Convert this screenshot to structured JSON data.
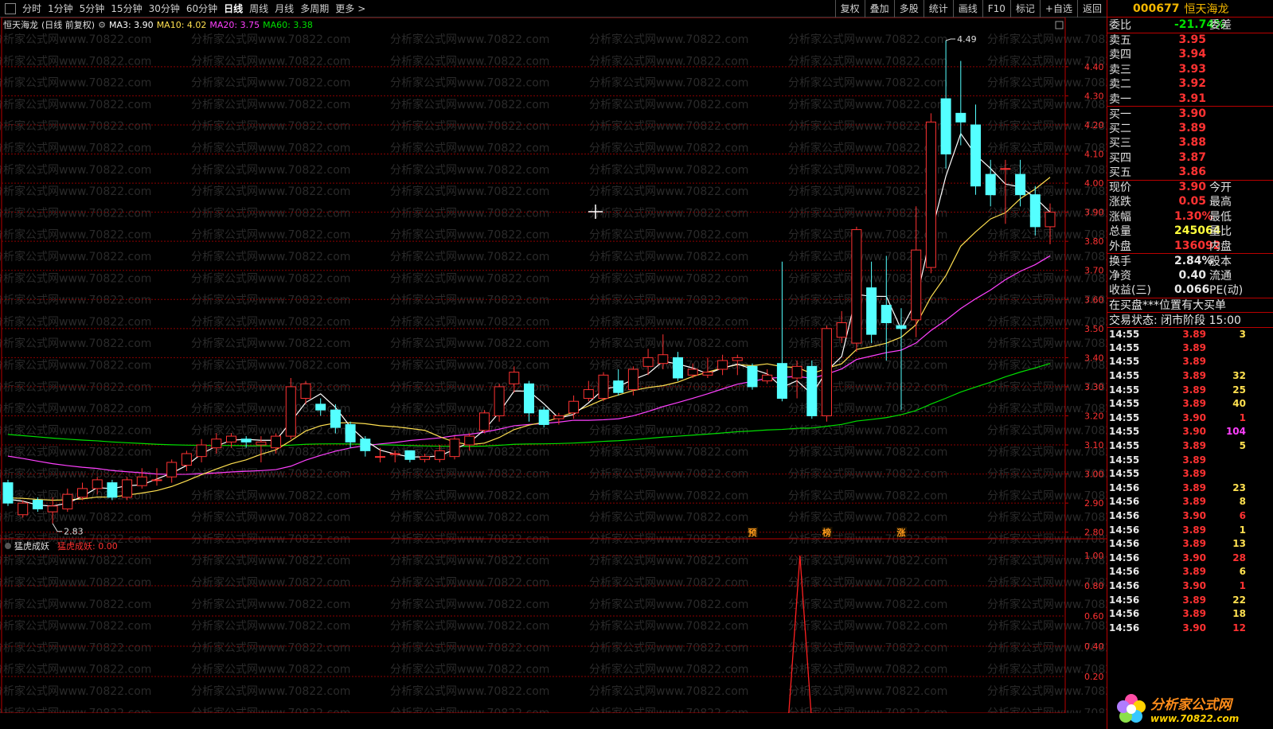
{
  "toolbar": {
    "tabs": [
      "分时",
      "1分钟",
      "5分钟",
      "15分钟",
      "30分钟",
      "60分钟",
      "日线",
      "周线",
      "月线",
      "多周期",
      "更多"
    ],
    "active_tab": "日线",
    "tools": [
      "复权",
      "叠加",
      "多股",
      "统计",
      "画线",
      "F10",
      "标记",
      "+自选",
      "返回"
    ]
  },
  "title_line": {
    "stock": "恒天海龙",
    "mode": "(日线 前复权)",
    "ma3": "MA3: 3.90",
    "ma10": "MA10: 4.02",
    "ma20": "MA20: 3.75",
    "ma60": "MA60: 3.38"
  },
  "indicator": {
    "name": "猛虎成妖",
    "value_label": "猛虎成妖: 0.00",
    "y_ticks": [
      "1.00",
      "0.80",
      "0.60",
      "0.40",
      "0.20"
    ],
    "signal_x_index": 54
  },
  "markers": {
    "hi_label": "4.49",
    "lo_label": "2.83",
    "events": [
      "预",
      "榜",
      "涨"
    ]
  },
  "watermark": "分析家公式网www.70822.com",
  "colors": {
    "up": "#ff3232",
    "down": "#54ffff",
    "ma3": "#ffffff",
    "ma10": "#ffe050",
    "ma20": "#ff40ff",
    "ma60": "#00e000",
    "grid": "#8c0000",
    "accent": "#f5b800"
  },
  "chart_data": {
    "type": "candlestick",
    "ylim": [
      2.78,
      4.52
    ],
    "y_ticks": [
      "4.40",
      "4.30",
      "4.20",
      "4.10",
      "4.00",
      "3.90",
      "3.80",
      "3.70",
      "3.60",
      "3.50",
      "3.40",
      "3.30",
      "3.20",
      "3.10",
      "3.00",
      "2.90",
      "2.80"
    ],
    "candles": [
      [
        2.97,
        2.9,
        2.98,
        2.89
      ],
      [
        2.86,
        2.9,
        2.91,
        2.85
      ],
      [
        2.91,
        2.88,
        2.92,
        2.87
      ],
      [
        2.87,
        2.89,
        2.92,
        2.83
      ],
      [
        2.88,
        2.93,
        2.95,
        2.87
      ],
      [
        2.92,
        2.95,
        2.97,
        2.91
      ],
      [
        2.95,
        2.98,
        2.99,
        2.93
      ],
      [
        2.97,
        2.92,
        2.98,
        2.91
      ],
      [
        2.92,
        2.98,
        2.99,
        2.91
      ],
      [
        2.96,
        2.99,
        3.02,
        2.95
      ],
      [
        2.98,
        2.98,
        3.02,
        2.96
      ],
      [
        2.99,
        3.04,
        3.05,
        2.97
      ],
      [
        3.03,
        3.07,
        3.08,
        3.01
      ],
      [
        3.06,
        3.1,
        3.12,
        3.04
      ],
      [
        3.09,
        3.12,
        3.14,
        3.07
      ],
      [
        3.11,
        3.13,
        3.14,
        3.09
      ],
      [
        3.12,
        3.11,
        3.13,
        3.09
      ],
      [
        3.1,
        3.11,
        3.13,
        3.04
      ],
      [
        3.09,
        3.13,
        3.14,
        3.07
      ],
      [
        3.13,
        3.3,
        3.33,
        3.12
      ],
      [
        3.26,
        3.31,
        3.32,
        3.24
      ],
      [
        3.24,
        3.22,
        3.26,
        3.2
      ],
      [
        3.22,
        3.16,
        3.24,
        3.14
      ],
      [
        3.17,
        3.11,
        3.18,
        3.09
      ],
      [
        3.12,
        3.08,
        3.13,
        3.06
      ],
      [
        3.06,
        3.06,
        3.09,
        3.04
      ],
      [
        3.07,
        3.07,
        3.08,
        3.04
      ],
      [
        3.08,
        3.05,
        3.08,
        3.04
      ],
      [
        3.05,
        3.06,
        3.07,
        3.04
      ],
      [
        3.05,
        3.08,
        3.1,
        3.04
      ],
      [
        3.06,
        3.12,
        3.13,
        3.05
      ],
      [
        3.1,
        3.13,
        3.14,
        3.08
      ],
      [
        3.15,
        3.21,
        3.22,
        3.14
      ],
      [
        3.2,
        3.3,
        3.31,
        3.18
      ],
      [
        3.31,
        3.35,
        3.37,
        3.28
      ],
      [
        3.31,
        3.21,
        3.32,
        3.18
      ],
      [
        3.22,
        3.17,
        3.23,
        3.16
      ],
      [
        3.19,
        3.2,
        3.21,
        3.17
      ],
      [
        3.21,
        3.25,
        3.27,
        3.19
      ],
      [
        3.26,
        3.29,
        3.32,
        3.25
      ],
      [
        3.26,
        3.34,
        3.35,
        3.25
      ],
      [
        3.32,
        3.28,
        3.36,
        3.27
      ],
      [
        3.29,
        3.36,
        3.37,
        3.27
      ],
      [
        3.37,
        3.4,
        3.43,
        3.34
      ],
      [
        3.38,
        3.41,
        3.48,
        3.36
      ],
      [
        3.4,
        3.33,
        3.42,
        3.32
      ],
      [
        3.34,
        3.36,
        3.38,
        3.33
      ],
      [
        3.34,
        3.35,
        3.4,
        3.33
      ],
      [
        3.36,
        3.39,
        3.41,
        3.34
      ],
      [
        3.39,
        3.4,
        3.41,
        3.34
      ],
      [
        3.37,
        3.3,
        3.38,
        3.29
      ],
      [
        3.32,
        3.34,
        3.36,
        3.31
      ],
      [
        3.38,
        3.26,
        3.73,
        3.25
      ],
      [
        3.33,
        3.37,
        3.39,
        3.26
      ],
      [
        3.37,
        3.2,
        3.39,
        3.19
      ],
      [
        3.2,
        3.5,
        3.51,
        3.18
      ],
      [
        3.47,
        3.52,
        3.56,
        3.45
      ],
      [
        3.45,
        3.84,
        3.85,
        3.42
      ],
      [
        3.64,
        3.48,
        3.73,
        3.45
      ],
      [
        3.58,
        3.52,
        3.75,
        3.39
      ],
      [
        3.51,
        3.5,
        3.57,
        3.22
      ],
      [
        3.53,
        3.77,
        3.92,
        3.47
      ],
      [
        3.71,
        4.21,
        4.24,
        3.69
      ],
      [
        4.29,
        4.1,
        4.49,
        4.05
      ],
      [
        4.24,
        4.21,
        4.42,
        4.13
      ],
      [
        4.2,
        3.99,
        4.27,
        3.96
      ],
      [
        4.03,
        3.96,
        4.08,
        3.92
      ],
      [
        4.05,
        4.05,
        4.08,
        3.86
      ],
      [
        4.03,
        3.96,
        4.08,
        3.92
      ],
      [
        3.96,
        3.85,
        3.99,
        3.82
      ],
      [
        3.85,
        3.9,
        3.93,
        3.79
      ]
    ],
    "ma3_end": 3.9,
    "ma10_end": 4.02,
    "ma20_end": 3.75,
    "ma60_end": 3.38
  },
  "quote": {
    "code": "000677",
    "name": "恒天海龙",
    "weibi": {
      "label": "委比",
      "value": "-21.74%",
      "label2": "委差"
    },
    "asks": [
      {
        "label": "卖五",
        "price": "3.95"
      },
      {
        "label": "卖四",
        "price": "3.94"
      },
      {
        "label": "卖三",
        "price": "3.93"
      },
      {
        "label": "卖二",
        "price": "3.92"
      },
      {
        "label": "卖一",
        "price": "3.91"
      }
    ],
    "bids": [
      {
        "label": "买一",
        "price": "3.90"
      },
      {
        "label": "买二",
        "price": "3.89"
      },
      {
        "label": "买三",
        "price": "3.88"
      },
      {
        "label": "买四",
        "price": "3.87"
      },
      {
        "label": "买五",
        "price": "3.86"
      }
    ],
    "stats1": [
      {
        "label": "现价",
        "value": "3.90",
        "color": "#ff3232",
        "label2": "今开"
      },
      {
        "label": "涨跌",
        "value": "0.05",
        "color": "#ff3232",
        "label2": "最高"
      },
      {
        "label": "涨幅",
        "value": "1.30%",
        "color": "#ff3232",
        "label2": "最低"
      },
      {
        "label": "总量",
        "value": "245064",
        "color": "#ffff3c",
        "label2": "量比"
      },
      {
        "label": "外盘",
        "value": "136092",
        "color": "#ff3232",
        "label2": "内盘"
      }
    ],
    "stats2": [
      {
        "label": "换手",
        "value": "2.84%",
        "color": "#e8e8e8",
        "label2": "股本"
      },
      {
        "label": "净资",
        "value": "0.40",
        "color": "#e8e8e8",
        "label2": "流通"
      },
      {
        "label": "收益(三)",
        "value": "0.066",
        "color": "#e8e8e8",
        "label2": "PE(动)"
      }
    ],
    "notice": "在买盘***位置有大买单",
    "trade_status": "交易状态: 闭市阶段 15:00",
    "ticks": [
      {
        "t": "14:55",
        "p": "3.89",
        "v": "3"
      },
      {
        "t": "14:55",
        "p": "3.89",
        "v": ""
      },
      {
        "t": "14:55",
        "p": "3.89",
        "v": ""
      },
      {
        "t": "14:55",
        "p": "3.89",
        "v": "32"
      },
      {
        "t": "14:55",
        "p": "3.89",
        "v": "25"
      },
      {
        "t": "14:55",
        "p": "3.89",
        "v": "40"
      },
      {
        "t": "14:55",
        "p": "3.90",
        "v": "1"
      },
      {
        "t": "14:55",
        "p": "3.90",
        "v": "104"
      },
      {
        "t": "14:55",
        "p": "3.89",
        "v": "5"
      },
      {
        "t": "14:55",
        "p": "3.89",
        "v": ""
      },
      {
        "t": "14:55",
        "p": "3.89",
        "v": ""
      },
      {
        "t": "14:56",
        "p": "3.89",
        "v": "23"
      },
      {
        "t": "14:56",
        "p": "3.89",
        "v": "8"
      },
      {
        "t": "14:56",
        "p": "3.90",
        "v": "6"
      },
      {
        "t": "14:56",
        "p": "3.89",
        "v": "1"
      },
      {
        "t": "14:56",
        "p": "3.89",
        "v": "13"
      },
      {
        "t": "14:56",
        "p": "3.90",
        "v": "28"
      },
      {
        "t": "14:56",
        "p": "3.89",
        "v": "6"
      },
      {
        "t": "14:56",
        "p": "3.90",
        "v": "1"
      },
      {
        "t": "14:56",
        "p": "3.89",
        "v": "22"
      },
      {
        "t": "14:56",
        "p": "3.89",
        "v": "18"
      },
      {
        "t": "14:56",
        "p": "3.90",
        "v": "12"
      }
    ],
    "logo_line1": "分析家公式网",
    "logo_line2": "www.70822.com"
  }
}
